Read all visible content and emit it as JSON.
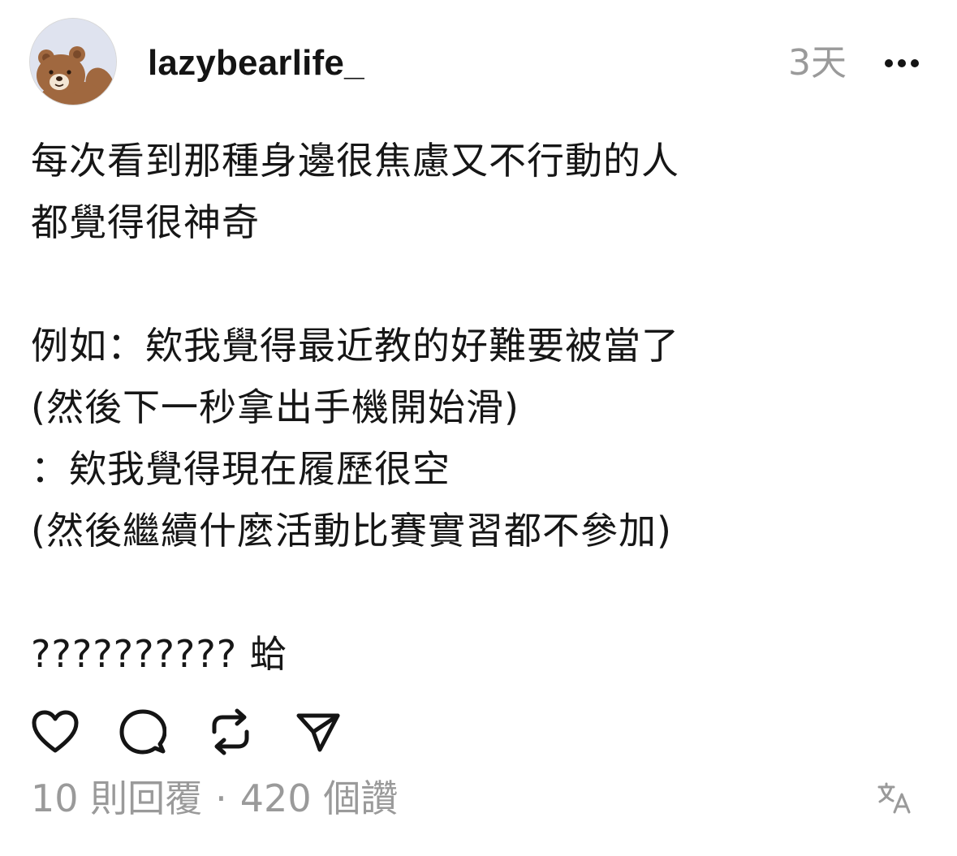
{
  "post": {
    "author": "lazybearlife_",
    "timestamp": "3天",
    "lines": [
      "每次看到那種身邊很焦慮又不行動的人",
      "都覺得很神奇",
      "",
      "例如：欸我覺得最近教的好難要被當了",
      "(然後下一秒拿出手機開始滑)",
      "：欸我覺得現在履歷很空",
      "(然後繼續什麼活動比賽實習都不參加)",
      "",
      "?????????? 蛤"
    ]
  },
  "actions": {
    "like_icon": "heart-icon",
    "reply_icon": "comment-icon",
    "repost_icon": "repost-icon",
    "share_icon": "send-icon"
  },
  "stats": {
    "replies": "10 則回覆",
    "separator": "·",
    "likes": "420 個讚"
  },
  "icons": {
    "more": "more-options-icon",
    "translate": "translate-icon"
  },
  "colors": {
    "text": "#161616",
    "muted": "#9a9a9a",
    "background": "#ffffff"
  }
}
